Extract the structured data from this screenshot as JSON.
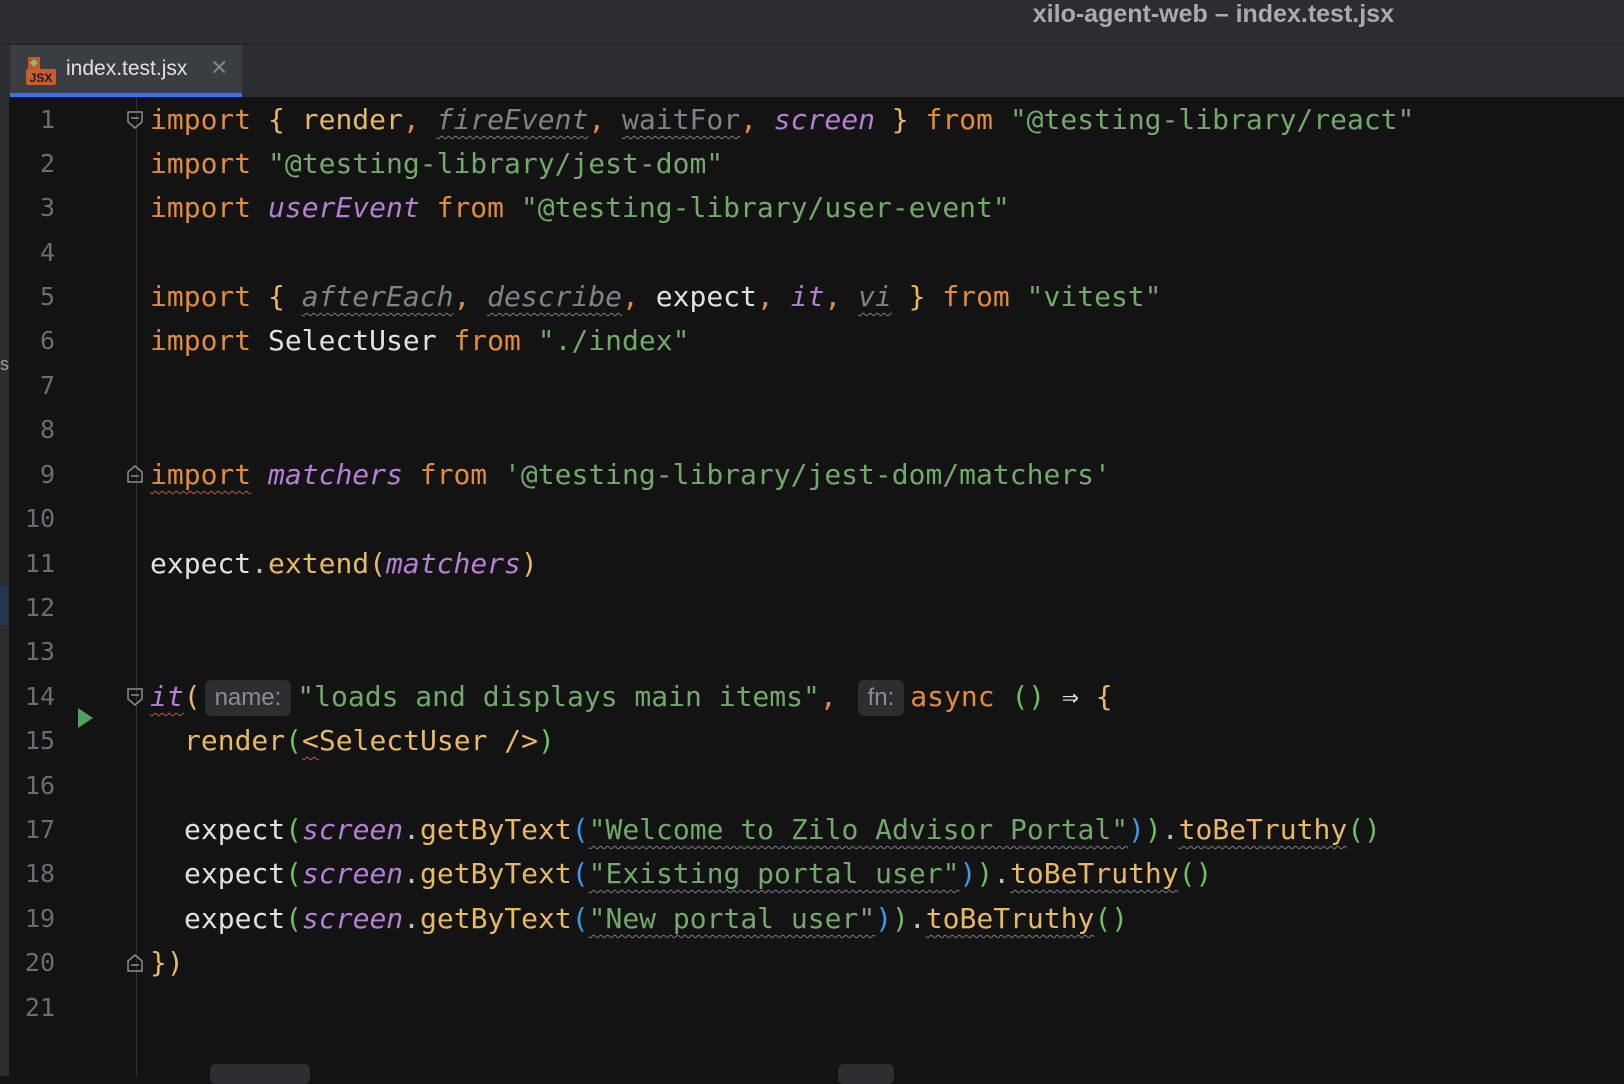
{
  "window": {
    "title": "xilo-agent-web – index.test.jsx"
  },
  "tabs": [
    {
      "label": "index.test.jsx",
      "icon": "jsx-file-icon",
      "icon_text": "JSX",
      "active": true
    }
  ],
  "left_strip": {
    "letter": "s"
  },
  "gutter": {
    "line_numbers": [
      "1",
      "2",
      "3",
      "4",
      "5",
      "6",
      "7",
      "8",
      "9",
      "10",
      "11",
      "12",
      "13",
      "14",
      "15",
      "16",
      "17",
      "18",
      "19",
      "20",
      "21"
    ]
  },
  "code": {
    "l1": {
      "import": "import",
      "open": "{",
      "render": "render",
      "c1": ",",
      "fireEvent": "fireEvent",
      "c2": ",",
      "waitFor": "waitFor",
      "c3": ",",
      "screen": "screen",
      "close": "}",
      "from": "from",
      "source": "\"@testing-library/react\""
    },
    "l2": {
      "import": "import",
      "source": "\"@testing-library/jest-dom\""
    },
    "l3": {
      "import": "import",
      "userEvent": "userEvent",
      "from": "from",
      "source": "\"@testing-library/user-event\""
    },
    "l5": {
      "import": "import",
      "open": "{",
      "afterEach": "afterEach",
      "c1": ",",
      "describe": "describe",
      "c2": ",",
      "expect": "expect",
      "c3": ",",
      "it": "it",
      "c4": ",",
      "vi": "vi",
      "close": "}",
      "from": "from",
      "source": "\"vitest\""
    },
    "l6": {
      "import": "import",
      "SelectUser": "SelectUser",
      "from": "from",
      "source": "\"./index\""
    },
    "l9": {
      "import": "import",
      "matchers": "matchers",
      "from": "from",
      "source": "'@testing-library/jest-dom/matchers'"
    },
    "l11": {
      "expect": "expect",
      "dot": ".",
      "extend": "extend",
      "open": "(",
      "matchers": "matchers",
      "close": ")"
    },
    "l14": {
      "it": "it",
      "open": "(",
      "hint_name": "name:",
      "title": "\"loads and displays main items\"",
      "comma": ",",
      "hint_fn": "fn:",
      "async": "async",
      "params": "()",
      "arrow": "⇒",
      "brace": "{"
    },
    "l15": {
      "render": "render",
      "open": "(",
      "lt": "<",
      "tag": "SelectUser",
      "selfclose": " />",
      "close": ")"
    },
    "l17": {
      "expect": "expect",
      "open": "(",
      "screen": "screen",
      "dot": ".",
      "getByText": "getByText",
      "open2": "(",
      "text": "\"Welcome to Zilo Advisor Portal\"",
      "close2": ")",
      "close": ")",
      "dot2": ".",
      "matcher": "toBeTruthy",
      "call": "()"
    },
    "l18": {
      "expect": "expect",
      "open": "(",
      "screen": "screen",
      "dot": ".",
      "getByText": "getByText",
      "open2": "(",
      "text": "\"Existing portal user\"",
      "close2": ")",
      "close": ")",
      "dot2": ".",
      "matcher": "toBeTruthy",
      "call": "()"
    },
    "l19": {
      "expect": "expect",
      "open": "(",
      "screen": "screen",
      "dot": ".",
      "getByText": "getByText",
      "open2": "(",
      "text": "\"New portal user\"",
      "close2": ")",
      "close": ")",
      "dot2": ".",
      "matcher": "toBeTruthy",
      "call": "()"
    },
    "l20": {
      "closing": "})"
    }
  },
  "colors": {
    "keyword": "#e08c3a",
    "string": "#72a96b",
    "function": "#e8b964",
    "italic_var": "#b57fd4",
    "plain": "#bcbec4",
    "accent": "#3574f0",
    "run": "#4fa35a"
  }
}
